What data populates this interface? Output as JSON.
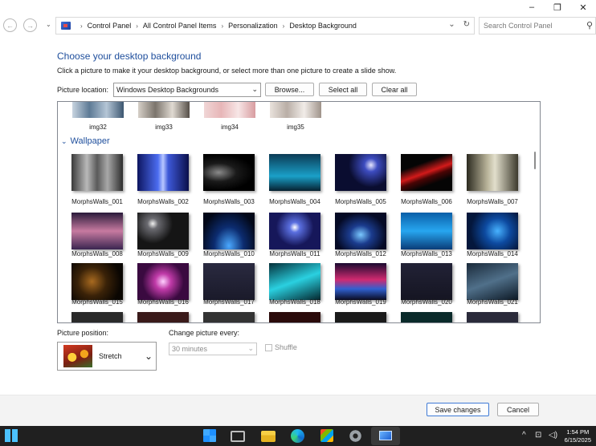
{
  "window": {
    "minimize_glyph": "–",
    "maximize_glyph": "❐",
    "close_glyph": "✕"
  },
  "address": {
    "breadcrumbs": [
      "Control Panel",
      "All Control Panel Items",
      "Personalization",
      "Desktop Background"
    ],
    "search_placeholder": "Search Control Panel"
  },
  "header": {
    "title": "Choose your desktop background",
    "subtitle": "Click a picture to make it your desktop background, or select more than one picture to create a slide show."
  },
  "location": {
    "label": "Picture location:",
    "value": "Windows Desktop Backgrounds",
    "browse": "Browse...",
    "select_all": "Select all",
    "clear_all": "Clear all"
  },
  "top_row": [
    "img32",
    "img33",
    "img34",
    "img35"
  ],
  "group": {
    "name": "Wallpaper"
  },
  "wallpapers": [
    [
      "MorphsWalls_001",
      "MorphsWalls_002",
      "MorphsWalls_003",
      "MorphsWalls_004",
      "MorphsWalls_005",
      "MorphsWalls_006",
      "MorphsWalls_007"
    ],
    [
      "MorphsWalls_008",
      "MorphsWalls_009",
      "MorphsWalls_010",
      "MorphsWalls_011",
      "MorphsWalls_012",
      "MorphsWalls_013",
      "MorphsWalls_014"
    ],
    [
      "MorphsWalls_015",
      "MorphsWalls_016",
      "MorphsWalls_017",
      "MorphsWalls_018",
      "MorphsWalls_019",
      "MorphsWalls_020",
      "MorphsWalls_021"
    ]
  ],
  "position": {
    "label": "Picture position:",
    "value": "Stretch"
  },
  "interval": {
    "label": "Change picture every:",
    "value": "30 minutes",
    "shuffle": "Shuffle"
  },
  "footer": {
    "save": "Save changes",
    "cancel": "Cancel"
  },
  "taskbar": {
    "time": "1:54 PM",
    "date": "6/15/2025"
  }
}
